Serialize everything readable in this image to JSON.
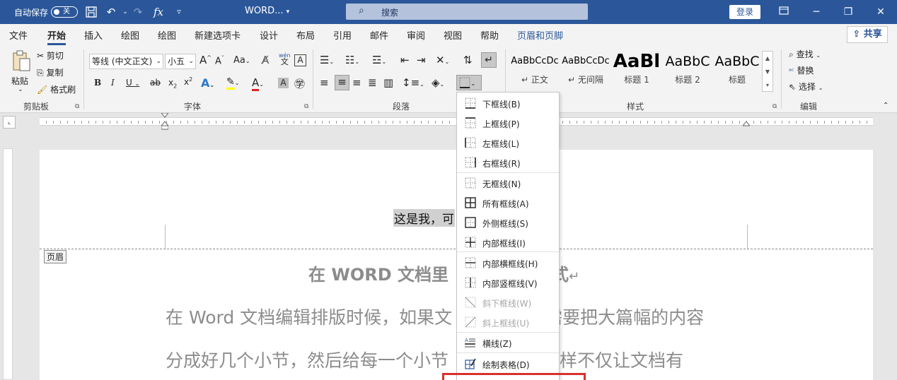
{
  "titlebar": {
    "autosave_label": "自动保存",
    "autosave_state": "关",
    "doc_name": "WORD...",
    "search_placeholder": "搜索",
    "login_label": "登录"
  },
  "menu": {
    "tabs": [
      "文件",
      "开始",
      "插入",
      "绘图",
      "绘图",
      "新建选项卡",
      "设计",
      "布局",
      "引用",
      "邮件",
      "审阅",
      "视图",
      "帮助",
      "页眉和页脚"
    ],
    "active_index": 1,
    "share_label": "共享"
  },
  "ribbon": {
    "clipboard": {
      "paste": "粘贴",
      "cut": "剪切",
      "copy": "复制",
      "format_painter": "格式刷",
      "label": "剪贴板"
    },
    "font": {
      "name": "等线 (中文正文)",
      "size": "小五",
      "label": "字体",
      "aa": "Aa",
      "grow": "A",
      "shrink": "A",
      "phonetic": "wén",
      "phonetic_char": "文",
      "box_char": "A"
    },
    "paragraph": {
      "label": "段落"
    },
    "styles": {
      "label": "样式",
      "items": [
        {
          "sample": "AaBbCcDc",
          "name": "正文"
        },
        {
          "sample": "AaBbCcDc",
          "name": "无间隔"
        },
        {
          "sample": "AaBl",
          "name": "标题 1"
        },
        {
          "sample": "AaBbC",
          "name": "标题 2"
        },
        {
          "sample": "AaBbC",
          "name": "标题"
        }
      ]
    },
    "editing": {
      "find": "查找",
      "replace": "替换",
      "select": "选择",
      "label": "编辑"
    }
  },
  "document": {
    "header_tag": "页眉",
    "header_text": "这是我，可",
    "title": "在 WORD 文档里",
    "title_end": "题样式",
    "title_mark": "↵",
    "para_line1_a": "在 Word 文档编辑排版时候，如果文",
    "para_line1_b": "，需要把大篇幅的内容",
    "para_line2_a": "分成好几个小节，然后给每一个小节",
    "para_line2_b": "题，这样不仅让文档有"
  },
  "border_menu": {
    "items": [
      {
        "label": "下框线(B)",
        "icon": "bottom-border-icon",
        "disabled": false
      },
      {
        "label": "上框线(P)",
        "icon": "top-border-icon",
        "disabled": false
      },
      {
        "label": "左框线(L)",
        "icon": "left-border-icon",
        "disabled": false
      },
      {
        "label": "右框线(R)",
        "icon": "right-border-icon",
        "disabled": false
      },
      {
        "label": "无框线(N)",
        "icon": "no-border-icon",
        "disabled": false
      },
      {
        "label": "所有框线(A)",
        "icon": "all-borders-icon",
        "disabled": false
      },
      {
        "label": "外侧框线(S)",
        "icon": "outside-borders-icon",
        "disabled": false
      },
      {
        "label": "内部框线(I)",
        "icon": "inside-borders-icon",
        "disabled": false
      },
      {
        "label": "内部横框线(H)",
        "icon": "inside-horizontal-border-icon",
        "disabled": false
      },
      {
        "label": "内部竖框线(V)",
        "icon": "inside-vertical-border-icon",
        "disabled": false
      },
      {
        "label": "斜下框线(W)",
        "icon": "diagonal-down-border-icon",
        "disabled": true
      },
      {
        "label": "斜上框线(U)",
        "icon": "diagonal-up-border-icon",
        "disabled": true
      },
      {
        "label": "横线(Z)",
        "icon": "horizontal-line-icon",
        "disabled": false
      },
      {
        "label": "绘制表格(D)",
        "icon": "draw-table-icon",
        "disabled": false
      }
    ]
  },
  "colors": {
    "brand": "#2b579a",
    "highlight_yellow": "#ffff00",
    "font_red": "#e02020",
    "callout_red": "#d9302c"
  }
}
